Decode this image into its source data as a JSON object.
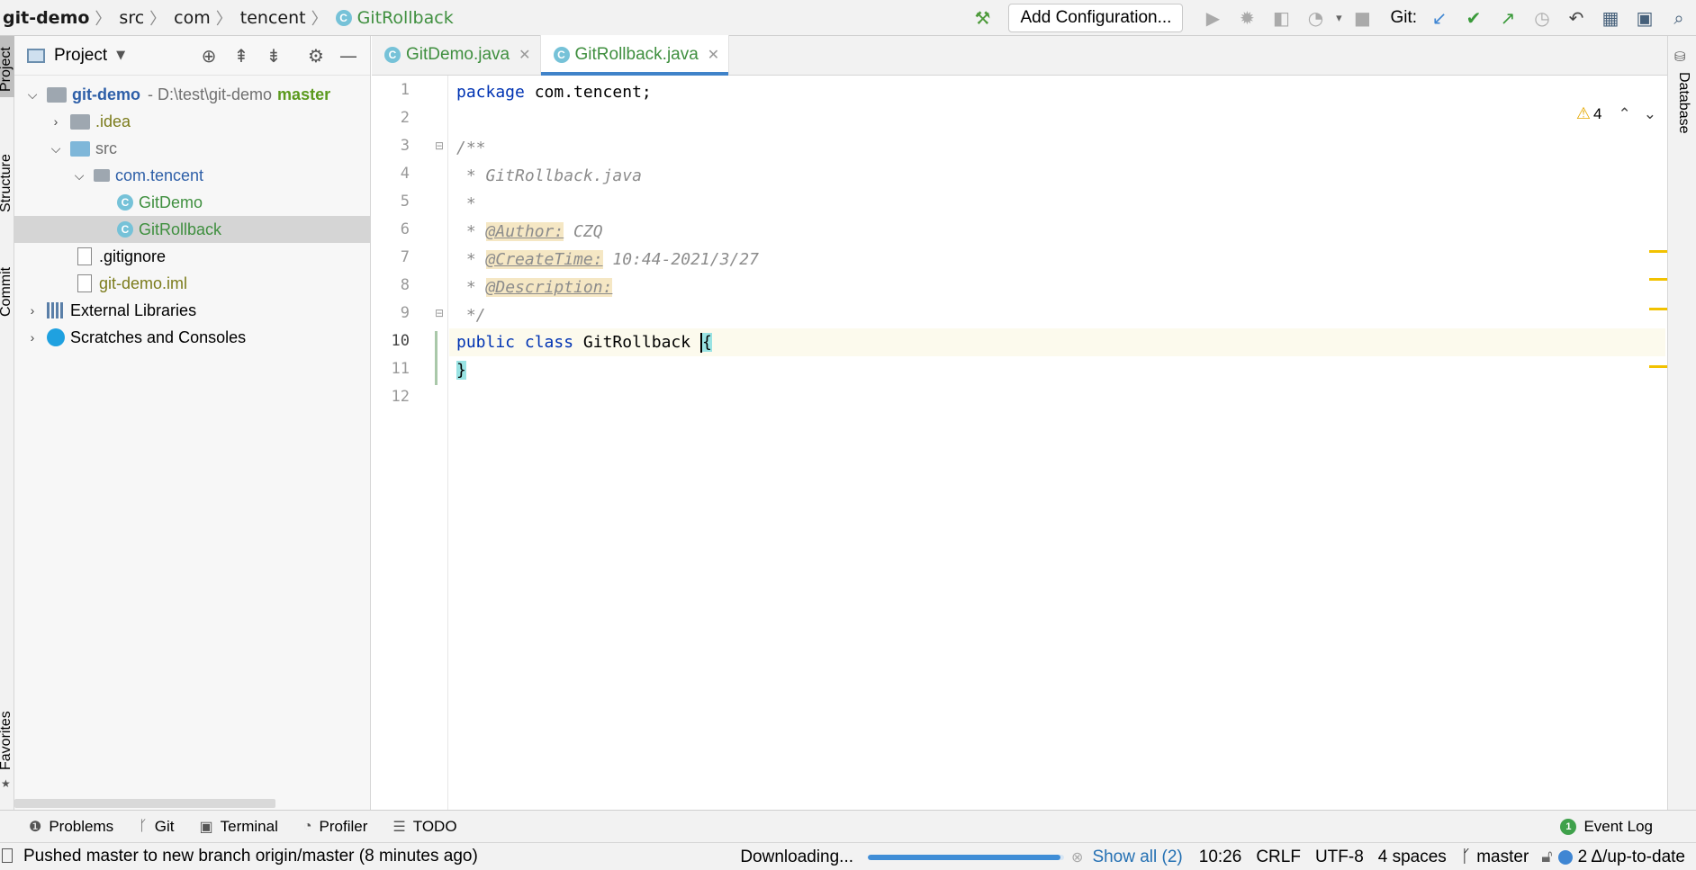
{
  "breadcrumbs": [
    {
      "label": "git-demo"
    },
    {
      "label": "src"
    },
    {
      "label": "com"
    },
    {
      "label": "tencent"
    },
    {
      "label": "GitRollback"
    }
  ],
  "toolbar": {
    "run_config_label": "Add Configuration...",
    "git_label": "Git:"
  },
  "left_stripe": {
    "project": "Project",
    "structure": "Structure",
    "commit": "Commit",
    "favorites": "Favorites"
  },
  "right_stripe": {
    "database": "Database"
  },
  "project_panel": {
    "title": "Project",
    "tree": {
      "root_name": "git-demo",
      "root_path": " - D:\\test\\git-demo",
      "root_branch": "master",
      "idea": ".idea",
      "src": "src",
      "package": "com.tencent",
      "file1": "GitDemo",
      "file2": "GitRollback",
      "gitignore": ".gitignore",
      "iml": "git-demo.iml",
      "libs": "External Libraries",
      "scratches": "Scratches and Consoles"
    }
  },
  "editor": {
    "tabs": [
      {
        "label": "GitDemo.java"
      },
      {
        "label": "GitRollback.java"
      }
    ],
    "line_numbers": [
      "1",
      "2",
      "3",
      "4",
      "5",
      "6",
      "7",
      "8",
      "9",
      "10",
      "11",
      "12"
    ],
    "code": {
      "l1_kw": "package",
      "l1_rest": " com.tencent;",
      "l3": "/**",
      "l4": " * GitRollback.java",
      "l5": " *",
      "l6_pre": " * ",
      "l6_tag": "@Author:",
      "l6_val": " CZQ",
      "l7_pre": " * ",
      "l7_tag": "@CreateTime:",
      "l7_val": " 10:44-2021/3/27",
      "l8_pre": " * ",
      "l8_tag": "@Description:",
      "l9": " */",
      "l10_kw1": "public",
      "l10_kw2": " class",
      "l10_name": " GitRollback ",
      "l10_brace": "{",
      "l11_brace": "}"
    },
    "warnings_count": "4"
  },
  "tool_windows": {
    "problems": "Problems",
    "git": "Git",
    "terminal": "Terminal",
    "profiler": "Profiler",
    "todo": "TODO",
    "event_log": "Event Log",
    "event_count": "1"
  },
  "status_bar": {
    "message": "Pushed master to new branch origin/master (8 minutes ago)",
    "downloading": "Downloading...",
    "download_progress": 0.98,
    "show_all": "Show all (2)",
    "position": "10:26",
    "line_sep": "CRLF",
    "encoding": "UTF-8",
    "indent": "4 spaces",
    "branch": "master",
    "vcs_status": "2 Δ/up-to-date"
  },
  "colors": {
    "accent": "#4083c9",
    "keyword": "#0033b3",
    "class_green": "#3f8f3f"
  }
}
